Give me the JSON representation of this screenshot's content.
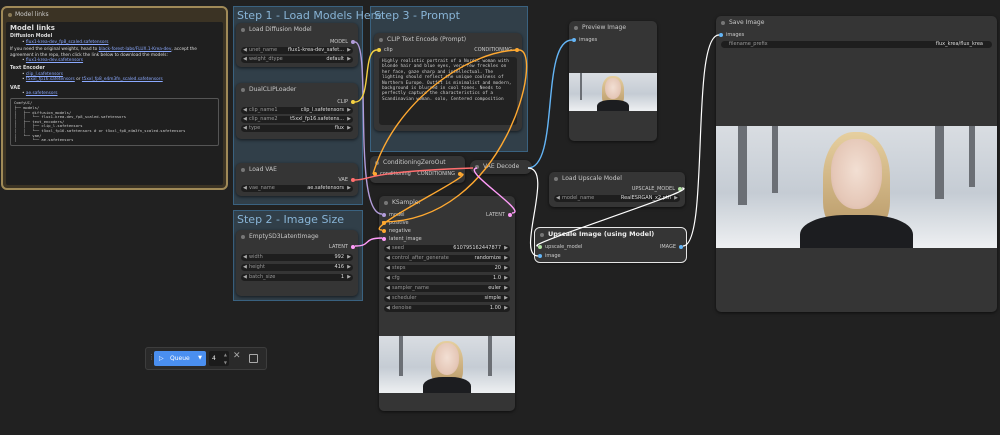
{
  "groups": {
    "step1": "Step 1 - Load Models Here",
    "step2": "Step 2 - Image Size",
    "step3": "Step 3 - Prompt"
  },
  "notes": {
    "title": "Model links",
    "heading": "Model links",
    "diffusion_header": "Diffusion Model",
    "diffusion_link": "flux1-krea-dev_fp8_scaled.safetensors",
    "original_text_a": "If you need the original weights, head to",
    "original_link": "black-forest-labs/FLUX.1-Krea-dev",
    "original_text_b": ", accept the agreement in the repo, then click the link below to download the models:",
    "original_file": "flux1-krea-dev.safetensors",
    "text_encoder_header": "Text Encoder",
    "te_link1": "clip_l.safetensors",
    "te_link2": "t5xxl_fp16.safetensors",
    "te_or": "or",
    "te_link3": "t5xxl_fp8_e4m3fn_scaled.safetensors",
    "vae_header": "VAE",
    "vae_link": "ae.safetensors",
    "tree": "ComfyUI/\n├── models/\n│   ├── diffusion_models/\n│   │   └── flux1-krea-dev_fp8_scaled.safetensors\n│   ├── text_encoders/\n│   │   ├── clip_l.safetensors\n│   │   └── t5xxl_fp16.safetensors # or t5xxl_fp8_e4m3fn_scaled.safetensors\n│   └── vae/\n│       └── ae.safetensors"
  },
  "nodes": {
    "load_diffusion": {
      "title": "Load Diffusion Model",
      "out": "MODEL",
      "w1_label": "unet_name",
      "w1_value": "flux1-krea-dev_safet...",
      "w2_label": "weight_dtype",
      "w2_value": "default"
    },
    "dual_clip": {
      "title": "DualCLIPLoader",
      "out": "CLIP",
      "w1_label": "clip_name1",
      "w1_value": "clip_l.safetensors",
      "w2_label": "clip_name2",
      "w2_value": "t5xxl_fp16.safetens...",
      "w3_label": "type",
      "w3_value": "flux"
    },
    "load_vae": {
      "title": "Load VAE",
      "out": "VAE",
      "w1_label": "vae_name",
      "w1_value": "ae.safetensors"
    },
    "empty_latent": {
      "title": "EmptySD3LatentImage",
      "out": "LATENT",
      "w1_label": "width",
      "w1_value": "992",
      "w2_label": "height",
      "w2_value": "416",
      "w3_label": "batch_size",
      "w3_value": "1"
    },
    "clip_text": {
      "title": "CLIP Text Encode (Prompt)",
      "in": "clip",
      "out": "CONDITIONING",
      "text": "Highly realistic portrait of a Nordic woman with blonde hair and blue eyes, very few freckles on her face, gaze sharp and intellectual. The lighting should reflect the unique coolness of Northern Europe. Outfit is minimalist and modern, background is blurred in cool tones. Needs to perfectly capture the characteristics of a Scandinavian woman. solo, Centered composition"
    },
    "cond_zero": {
      "title": "ConditioningZeroOut",
      "in": "conditioning",
      "out": "CONDITIONING"
    },
    "vae_decode": {
      "title": "VAE Decode"
    },
    "ksampler": {
      "title": "KSampler",
      "in1": "model",
      "in2": "positive",
      "in3": "negative",
      "in4": "latent_image",
      "out": "LATENT",
      "w1_label": "seed",
      "w1_value": "610795162447877",
      "w2_label": "control_after_generate",
      "w2_value": "randomize",
      "w3_label": "steps",
      "w3_value": "20",
      "w4_label": "cfg",
      "w4_value": "1.0",
      "w5_label": "sampler_name",
      "w5_value": "euler",
      "w6_label": "scheduler",
      "w6_value": "simple",
      "w7_label": "denoise",
      "w7_value": "1.00"
    },
    "preview": {
      "title": "Preview Image",
      "in": "images"
    },
    "load_upscale": {
      "title": "Load Upscale Model",
      "out": "UPSCALE_MODEL",
      "w1_label": "model_name",
      "w1_value": "RealESRGAN_x2.pth"
    },
    "upscale": {
      "title": "Upscale Image (using Model)",
      "in1": "upscale_model",
      "in2": "image",
      "out": "IMAGE"
    },
    "save": {
      "title": "Save Image",
      "in": "images",
      "w1_label": "filename_prefix",
      "w1_value": "flux_krea/flux_krea"
    }
  },
  "queue": {
    "label": "Queue",
    "count": "4"
  },
  "colors": {
    "model": "#b39ddb",
    "clip": "#f5d142",
    "vae": "#ff6e6e",
    "conditioning": "#ffa931",
    "latent": "#ff9cf9",
    "image": "#64b5f6",
    "upscale_model": "#b0e0a0",
    "queue_button": "#4a8ff0"
  },
  "icons": [
    "grip-icon",
    "play-icon",
    "chevron-down-icon",
    "close-icon",
    "square-icon"
  ]
}
